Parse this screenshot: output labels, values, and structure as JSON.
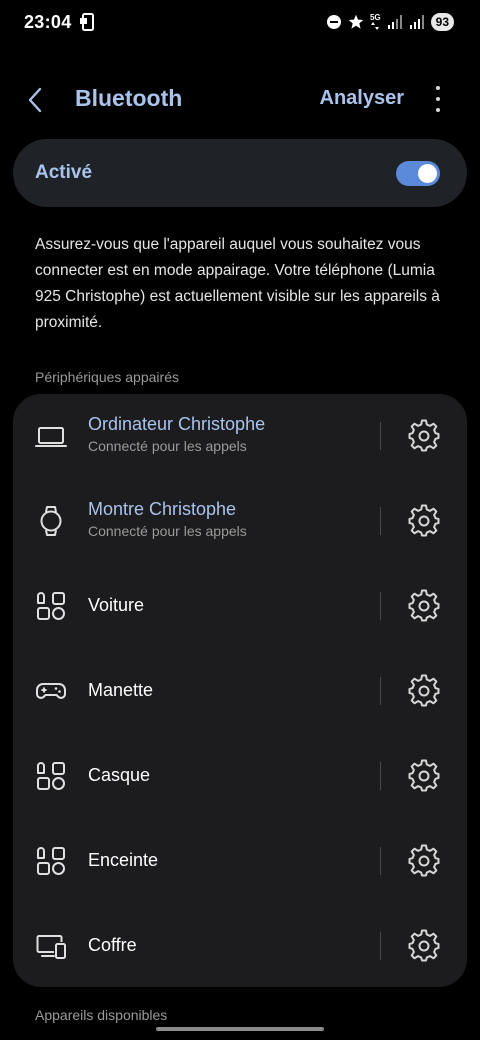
{
  "status_bar": {
    "time": "23:04",
    "network_label": "5G",
    "battery": "93"
  },
  "header": {
    "title": "Bluetooth",
    "action_label": "Analyser"
  },
  "toggle": {
    "label": "Activé",
    "state": "on",
    "accent_color": "#5b8ad8"
  },
  "description": "Assurez-vous que l'appareil auquel vous souhaitez vous connecter est en mode appairage. Votre téléphone (Lumia 925 Christophe) est actuellement visible sur les appareils à proximité.",
  "paired_section": {
    "header": "Périphériques appairés",
    "devices": [
      {
        "name": "Ordinateur Christophe",
        "status": "Connecté pour les appels",
        "icon": "laptop-icon"
      },
      {
        "name": "Montre Christophe",
        "status": "Connecté pour les appels",
        "icon": "watch-icon"
      },
      {
        "name": "Voiture",
        "status": "",
        "icon": "generic-device-icon"
      },
      {
        "name": "Manette",
        "status": "",
        "icon": "gamepad-icon"
      },
      {
        "name": "Casque",
        "status": "",
        "icon": "generic-device-icon"
      },
      {
        "name": "Enceinte",
        "status": "",
        "icon": "generic-device-icon"
      },
      {
        "name": "Coffre",
        "status": "",
        "icon": "computer-phone-icon"
      }
    ]
  },
  "available_section": {
    "header": "Appareils disponibles"
  },
  "colors": {
    "accent_text": "#a9c4ec",
    "background": "#000000",
    "card": "#1c1c1e"
  }
}
